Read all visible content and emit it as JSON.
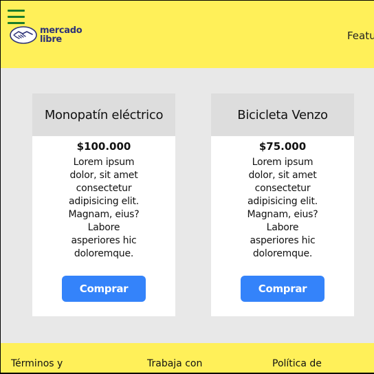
{
  "header": {
    "logo_line1": "mercado",
    "logo_line2": "libre",
    "nav_link": "Featu",
    "icons": [
      "hamburger-menu-icon",
      "handshake-logo-icon"
    ],
    "colors": {
      "header_bg": "#fff059",
      "menu_icon": "#1a7c2a",
      "logo_text": "#2d3277"
    }
  },
  "products": [
    {
      "title": "Monopatín eléctrico",
      "price": "$100.000",
      "desc_lines": [
        "Lorem ipsum",
        "dolor, sit amet",
        "consectetur",
        "adipisicing elit.",
        "Magnam, eius?",
        "Labore",
        "asperiores hic",
        "doloremque."
      ],
      "button": "Comprar"
    },
    {
      "title": "Bicicleta Venzo",
      "price": "$75.000",
      "desc_lines": [
        "Lorem ipsum",
        "dolor, sit amet",
        "consectetur",
        "adipisicing elit.",
        "Magnam, eius?",
        "Labore",
        "asperiores hic",
        "doloremque."
      ],
      "button": "Comprar"
    }
  ],
  "footer": {
    "links": [
      "Términos y",
      "Trabaja con",
      "Política de"
    ]
  },
  "colors": {
    "button": "#3483fa",
    "page_bg": "#e8e8e8",
    "card_head": "#dddddd"
  }
}
